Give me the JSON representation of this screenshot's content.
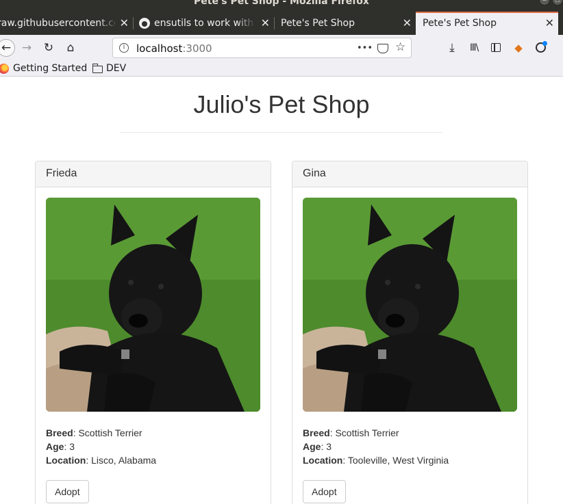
{
  "window": {
    "title": "Pete's Pet Shop - Mozilla Firefox"
  },
  "tabs": [
    {
      "label": "raw.githubusercontent.co"
    },
    {
      "label": "ensutils to work with R"
    },
    {
      "label": "Pete's Pet Shop"
    },
    {
      "label": "Pete's Pet Shop",
      "active": true
    }
  ],
  "navbar": {
    "url_host": "localhost",
    "url_port": ":3000",
    "more_label": "•••"
  },
  "bookmarks": [
    {
      "label": "Getting Started"
    },
    {
      "label": "DEV"
    }
  ],
  "page": {
    "title": "Julio's Pet Shop",
    "pets": [
      {
        "name": "Frieda",
        "breed_label": "Breed",
        "breed": "Scottish Terrier",
        "age_label": "Age",
        "age": "3",
        "location_label": "Location",
        "location": "Lisco, Alabama",
        "button": "Adopt"
      },
      {
        "name": "Gina",
        "breed_label": "Breed",
        "breed": "Scottish Terrier",
        "age_label": "Age",
        "age": "3",
        "location_label": "Location",
        "location": "Tooleville, West Virginia",
        "button": "Adopt"
      }
    ]
  },
  "colors": {
    "active_tab_accent": "#e2704a",
    "chrome_dark": "#2f2f2c",
    "toolbar": "#f0f0f4"
  }
}
